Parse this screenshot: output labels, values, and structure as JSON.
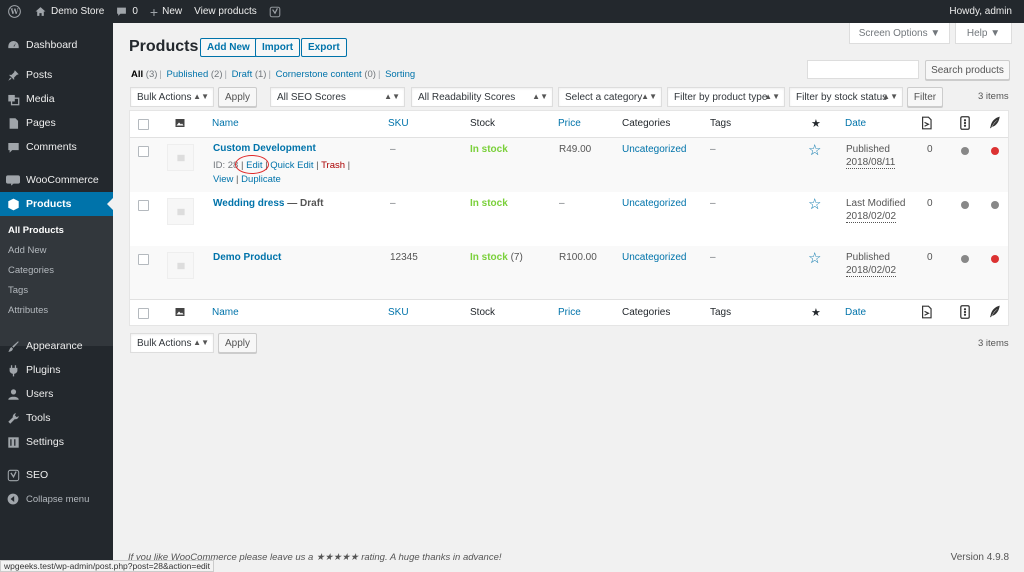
{
  "adminbar": {
    "site_name": "Demo Store",
    "comments_count": "0",
    "new_label": "New",
    "view_products_label": "View products",
    "greeting": "Howdy, admin"
  },
  "sidebar": {
    "items": [
      {
        "label": "Dashboard",
        "icon": "dashboard-icon"
      },
      {
        "label": "Posts",
        "icon": "pin-icon"
      },
      {
        "label": "Media",
        "icon": "media-icon"
      },
      {
        "label": "Pages",
        "icon": "pages-icon"
      },
      {
        "label": "Comments",
        "icon": "comment-icon"
      },
      {
        "label": "WooCommerce",
        "icon": "woo-icon"
      },
      {
        "label": "Products",
        "icon": "box-icon"
      },
      {
        "label": "Appearance",
        "icon": "brush-icon"
      },
      {
        "label": "Plugins",
        "icon": "plug-icon"
      },
      {
        "label": "Users",
        "icon": "user-icon"
      },
      {
        "label": "Tools",
        "icon": "wrench-icon"
      },
      {
        "label": "Settings",
        "icon": "settings-icon"
      },
      {
        "label": "SEO",
        "icon": "yoast-icon"
      },
      {
        "label": "Collapse menu",
        "icon": "collapse-icon"
      }
    ],
    "submenu": [
      "All Products",
      "Add New",
      "Categories",
      "Tags",
      "Attributes"
    ]
  },
  "screen_options_label": "Screen Options ▼",
  "help_label": "Help ▼",
  "page": {
    "title": "Products",
    "add_new": "Add New",
    "import": "Import",
    "export": "Export"
  },
  "views": [
    {
      "label": "All",
      "count": "(3)"
    },
    {
      "label": "Published",
      "count": "(2)"
    },
    {
      "label": "Draft",
      "count": "(1)"
    },
    {
      "label": "Cornerstone content",
      "count": "(0)"
    },
    {
      "label": "Sorting",
      "count": ""
    }
  ],
  "search_button": "Search products",
  "filters": {
    "bulk_actions": "Bulk Actions",
    "apply": "Apply",
    "seo_scores": "All SEO Scores",
    "readability": "All Readability Scores",
    "category": "Select a category",
    "product_type": "Filter by product type",
    "stock_status": "Filter by stock status",
    "filter_button": "Filter",
    "items_count": "3 items"
  },
  "columns": {
    "name": "Name",
    "sku": "SKU",
    "stock": "Stock",
    "price": "Price",
    "categories": "Categories",
    "tags": "Tags",
    "date": "Date"
  },
  "rows": [
    {
      "name": "Custom Development",
      "suffix": "",
      "sku": "–",
      "stock": "In stock",
      "stock_extra": "",
      "price": "R49.00",
      "category": "Uncategorized",
      "tags": "–",
      "date_status": "Published",
      "date": "2018/08/11",
      "count": "0",
      "seo_color": "#888888",
      "read_color": "#dc3232",
      "actions": {
        "id": "ID: 28",
        "edit": "Edit",
        "quick_edit": "Quick Edit",
        "trash": "Trash",
        "view": "View",
        "duplicate": "Duplicate"
      }
    },
    {
      "name": "Wedding dress",
      "suffix": "— Draft",
      "sku": "–",
      "stock": "In stock",
      "stock_extra": "",
      "price": "–",
      "category": "Uncategorized",
      "tags": "–",
      "date_status": "Last Modified",
      "date": "2018/02/02",
      "count": "0",
      "seo_color": "#888888",
      "read_color": "#888888"
    },
    {
      "name": "Demo Product",
      "suffix": "",
      "sku": "12345",
      "stock": "In stock",
      "stock_extra": "(7)",
      "price": "R100.00",
      "category": "Uncategorized",
      "tags": "–",
      "date_status": "Published",
      "date": "2018/02/02",
      "count": "0",
      "seo_color": "#888888",
      "read_color": "#dc3232"
    }
  ],
  "footer": {
    "thanks": "If you like WooCommerce please leave us a ★★★★★ rating. A huge thanks in advance!",
    "version": "Version 4.9.8"
  },
  "status_url": "wpgeeks.test/wp-admin/post.php?post=28&action=edit"
}
